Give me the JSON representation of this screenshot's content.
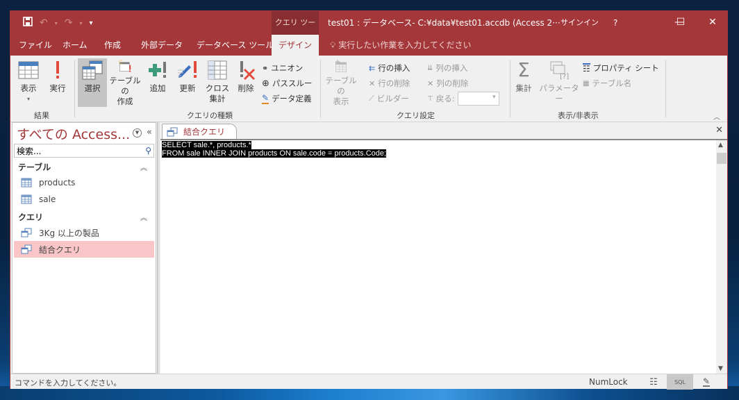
{
  "qat": {
    "save": "save-icon",
    "undo": "↶",
    "redo": "↷",
    "customize": "▾"
  },
  "titlebar": {
    "context_tab": "クエリ ツール",
    "title": "test01 : データベース- C:¥data¥test01.accdb (Access 2···",
    "signin": "サインイン",
    "help": "?",
    "minimize": "—",
    "maximize": "☐",
    "close": "✕"
  },
  "tabs": [
    {
      "label": "ファイル"
    },
    {
      "label": "ホーム"
    },
    {
      "label": "作成"
    },
    {
      "label": "外部データ"
    },
    {
      "label": "データベース ツール"
    },
    {
      "label": "デザイン",
      "active": true
    }
  ],
  "tellme": "実行したい作業を入力してください",
  "ribbon": {
    "groups": {
      "results": "結果",
      "query_type": "クエリの種類",
      "query_setup": "クエリ設定",
      "show_hide": "表示/非表示"
    },
    "buttons": {
      "view": "表示",
      "run": "実行",
      "select": "選択",
      "make_table_1": "テーブルの",
      "make_table_2": "作成",
      "append": "追加",
      "update": "更新",
      "crosstab_1": "クロス",
      "crosstab_2": "集計",
      "delete": "削除",
      "union": "ユニオン",
      "passthrough": "パススルー",
      "data_definition": "データ定義",
      "show_table_1": "テーブルの",
      "show_table_2": "表示",
      "insert_rows": "行の挿入",
      "delete_rows": "行の削除",
      "builder": "ビルダー",
      "insert_columns": "列の挿入",
      "delete_columns": "列の削除",
      "return_label": "戻る:",
      "return_value": "",
      "totals": "集計",
      "parameters": "パラメーター",
      "property_sheet": "プロパティ シート",
      "table_names": "テーブル名"
    }
  },
  "nav": {
    "title": "すべての Access...",
    "search_placeholder": "検索...",
    "groups": [
      {
        "label": "テーブル",
        "items": [
          "products",
          "sale"
        ]
      },
      {
        "label": "クエリ",
        "items": [
          "3Kg 以上の製品",
          "結合クエリ"
        ]
      }
    ],
    "selected": "結合クエリ"
  },
  "document": {
    "tab_label": "結合クエリ",
    "sql_lines": [
      "SELECT sale.*, products.*",
      "FROM sale INNER JOIN products ON sale.code = products.Code;"
    ]
  },
  "status": {
    "message": "コマンドを入力してください。",
    "numlock": "NumLock",
    "sql_view": "SQL"
  },
  "colors": {
    "accent": "#a4373a",
    "selected_nav": "#f9c5c6"
  }
}
